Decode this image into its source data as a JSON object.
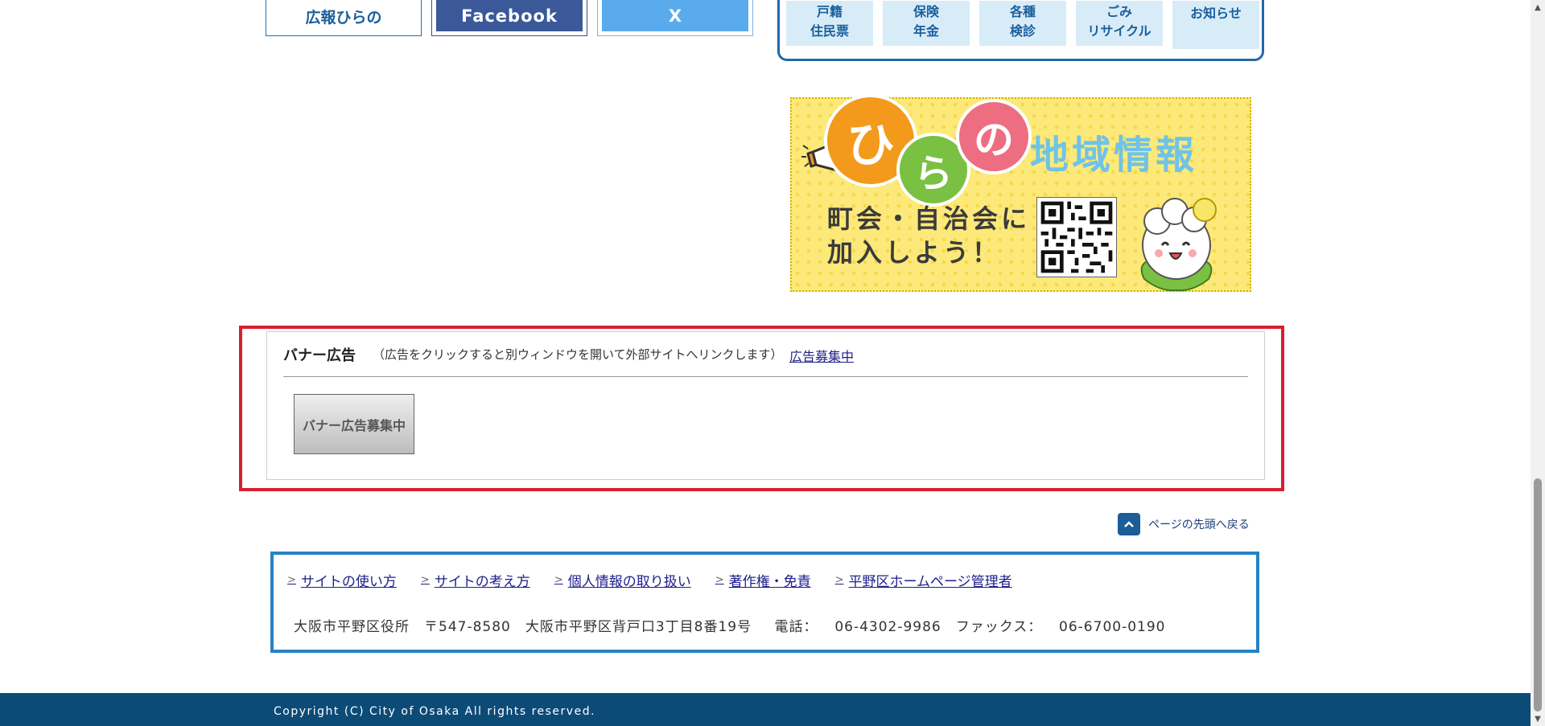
{
  "top_buttons": {
    "koho": "広報ひらの",
    "facebook": "Facebook",
    "x": "X"
  },
  "categories": [
    {
      "line1": "戸籍",
      "line2": "住民票"
    },
    {
      "line1": "保険",
      "line2": "年金"
    },
    {
      "line1": "各種",
      "line2": "検診"
    },
    {
      "line1": "ごみ",
      "line2": "リサイクル"
    },
    {
      "line1": "お知らせ",
      "line2": ""
    }
  ],
  "local_banner": {
    "hira": "ひ",
    "ra": "ら",
    "no": "の",
    "title": "地域情報",
    "line1": "町会・自治会に",
    "line2": "加入しよう！"
  },
  "ad_section": {
    "title": "バナー広告",
    "note": "（広告をクリックすると別ウィンドウを開いて外部サイトへリンクします）",
    "recruit_link": "広告募集中",
    "banner_label": "バナー広告募集中"
  },
  "back_to_top": "ページの先頭へ戻る",
  "footer": {
    "links": [
      "サイトの使い方",
      "サイトの考え方",
      "個人情報の取り扱い",
      "著作権・免責",
      "平野区ホームページ管理者"
    ],
    "address": "大阪市平野区役所　〒547-8580　大阪市平野区背戸口3丁目8番19号　 電話：  06-4302-9986　ファックス：  06-6700-0190"
  },
  "copyright": "Copyright (C) City of Osaka All rights reserved.",
  "colors": {
    "accent_blue": "#2468a8",
    "ad_border_red": "#d7202e",
    "footer_blue": "#2582c4",
    "copyright_bg": "#0d4b77"
  }
}
